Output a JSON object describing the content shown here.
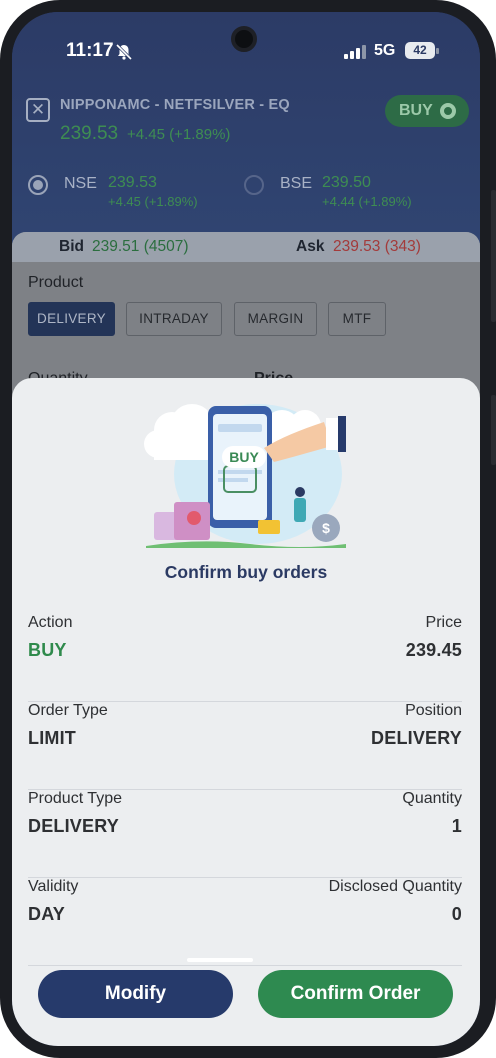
{
  "status_bar": {
    "time": "11:17",
    "network": "5G",
    "battery": "42"
  },
  "instrument": {
    "name": "NIPPONAMC - NETFSILVER - EQ",
    "price": "239.53",
    "change": "+4.45 (+1.89%)",
    "side_label": "BUY"
  },
  "exchanges": [
    {
      "label": "NSE",
      "price": "239.53",
      "change": "+4.45 (+1.89%)",
      "selected": true
    },
    {
      "label": "BSE",
      "price": "239.50",
      "change": "+4.44 (+1.89%)",
      "selected": false
    }
  ],
  "bid_ask": {
    "bid_label": "Bid",
    "bid_value": "239.51 (4507)",
    "ask_label": "Ask",
    "ask_value": "239.53 (343)"
  },
  "form": {
    "product_label": "Product",
    "product_tabs": [
      "DELIVERY",
      "INTRADAY",
      "MARGIN",
      "MTF"
    ],
    "active_tab": "DELIVERY",
    "quantity_label": "Quantity",
    "price_label": "Price"
  },
  "sheet": {
    "illustration_text": "BUY",
    "title": "Confirm buy orders",
    "rows": [
      {
        "left_key": "Action",
        "left_value": "BUY",
        "right_key": "Price",
        "right_value": "239.45"
      },
      {
        "left_key": "Order Type",
        "left_value": "LIMIT",
        "right_key": "Position",
        "right_value": "DELIVERY"
      },
      {
        "left_key": "Product Type",
        "left_value": "DELIVERY",
        "right_key": "Quantity",
        "right_value": "1"
      },
      {
        "left_key": "Validity",
        "left_value": "DAY",
        "right_key": "Disclosed Quantity",
        "right_value": "0"
      }
    ],
    "modify_label": "Modify",
    "confirm_label": "Confirm Order"
  },
  "colors": {
    "header_bg": "#2c3b66",
    "accent_green": "#2e8a50",
    "primary_navy": "#263a6b",
    "ask_red": "#a33b3b"
  }
}
